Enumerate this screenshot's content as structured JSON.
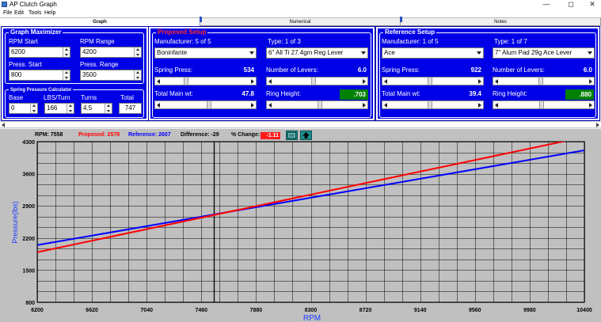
{
  "window": {
    "title": "AP Clutch Graph",
    "minimize": "—",
    "maximize": "◻",
    "close": "✕"
  },
  "menu": [
    "File",
    "Edit",
    "Tools",
    "Help"
  ],
  "tabs": [
    "Graph",
    "Numerical",
    "Notes"
  ],
  "graph_maximizer": {
    "title": "Graph Maximizer",
    "rpm_start_label": "RPM Start",
    "rpm_start": "6200",
    "rpm_range_label": "RPM Range",
    "rpm_range": "4200",
    "press_start_label": "Press. Start",
    "press_start": "800",
    "press_range_label": "Press. Range",
    "press_range": "3500"
  },
  "spring_calc": {
    "title": "Spring Pressure Calculator",
    "base_label": "Base",
    "base": "0",
    "lbs_turn_label": "LBS/Turn",
    "lbs_turn": "166",
    "turns_label": "Turns",
    "turns": "4.5",
    "total_label": "Total",
    "total": "747"
  },
  "proposed": {
    "title": "Proposed Setup",
    "manufacturer_label": "Manufacturer:  5 of  5",
    "manufacturer": "Boninfante",
    "type_label": "Type:  1 of  3",
    "type": "6\" All Ti 27.4gm Reg Lever",
    "spring_press_label": "Spring Press:",
    "spring_press": "534",
    "levers_label": "Number of Levers:",
    "levers": "6.0",
    "main_wt_label": "Total Main wt:",
    "main_wt": "47.8",
    "ring_label": "Ring Height:",
    "ring": ".703"
  },
  "reference": {
    "title": "Reference Setup",
    "manufacturer_label": "Manufacturer:  1 of  5",
    "manufacturer": "Ace",
    "type_label": "Type:  1 of  7",
    "type": "7\" Alum Pad 29g Ace Lever",
    "spring_press_label": "Spring Press:",
    "spring_press": "922",
    "levers_label": "Number of Levers:",
    "levers": "6.0",
    "main_wt_label": "Total Main wt:",
    "main_wt": "39.4",
    "ring_label": "Ring Height:",
    "ring": ".880"
  },
  "status": {
    "rpm": "RPM:  7558",
    "proposed": "Proposed:  2578",
    "reference": "Reference:  2607",
    "difference": "Difference:  -29",
    "pct_label": "% Change:",
    "pct": "-1.11"
  },
  "colors": {
    "panel": "#0000e6",
    "proposed": "#ff0000",
    "reference": "#0000ff",
    "green": "#008000"
  },
  "chart_data": {
    "type": "line",
    "xlabel": "RPM",
    "ylabel": "Pressure(lbs)",
    "xlim": [
      6200,
      10400
    ],
    "ylim": [
      800,
      4300
    ],
    "x_ticks": [
      6200,
      6620,
      7040,
      7460,
      7880,
      8300,
      8720,
      9140,
      9560,
      9980,
      10400
    ],
    "y_ticks": [
      800,
      1500,
      2200,
      2900,
      3600,
      4300
    ],
    "cursor_rpm": 7558,
    "series": [
      {
        "name": "Proposed",
        "color": "#ff0000",
        "x": [
          6200,
          10400
        ],
        "y": [
          1890,
          4400
        ]
      },
      {
        "name": "Reference",
        "color": "#0000ff",
        "x": [
          6200,
          10400
        ],
        "y": [
          2045,
          4110
        ]
      }
    ]
  }
}
